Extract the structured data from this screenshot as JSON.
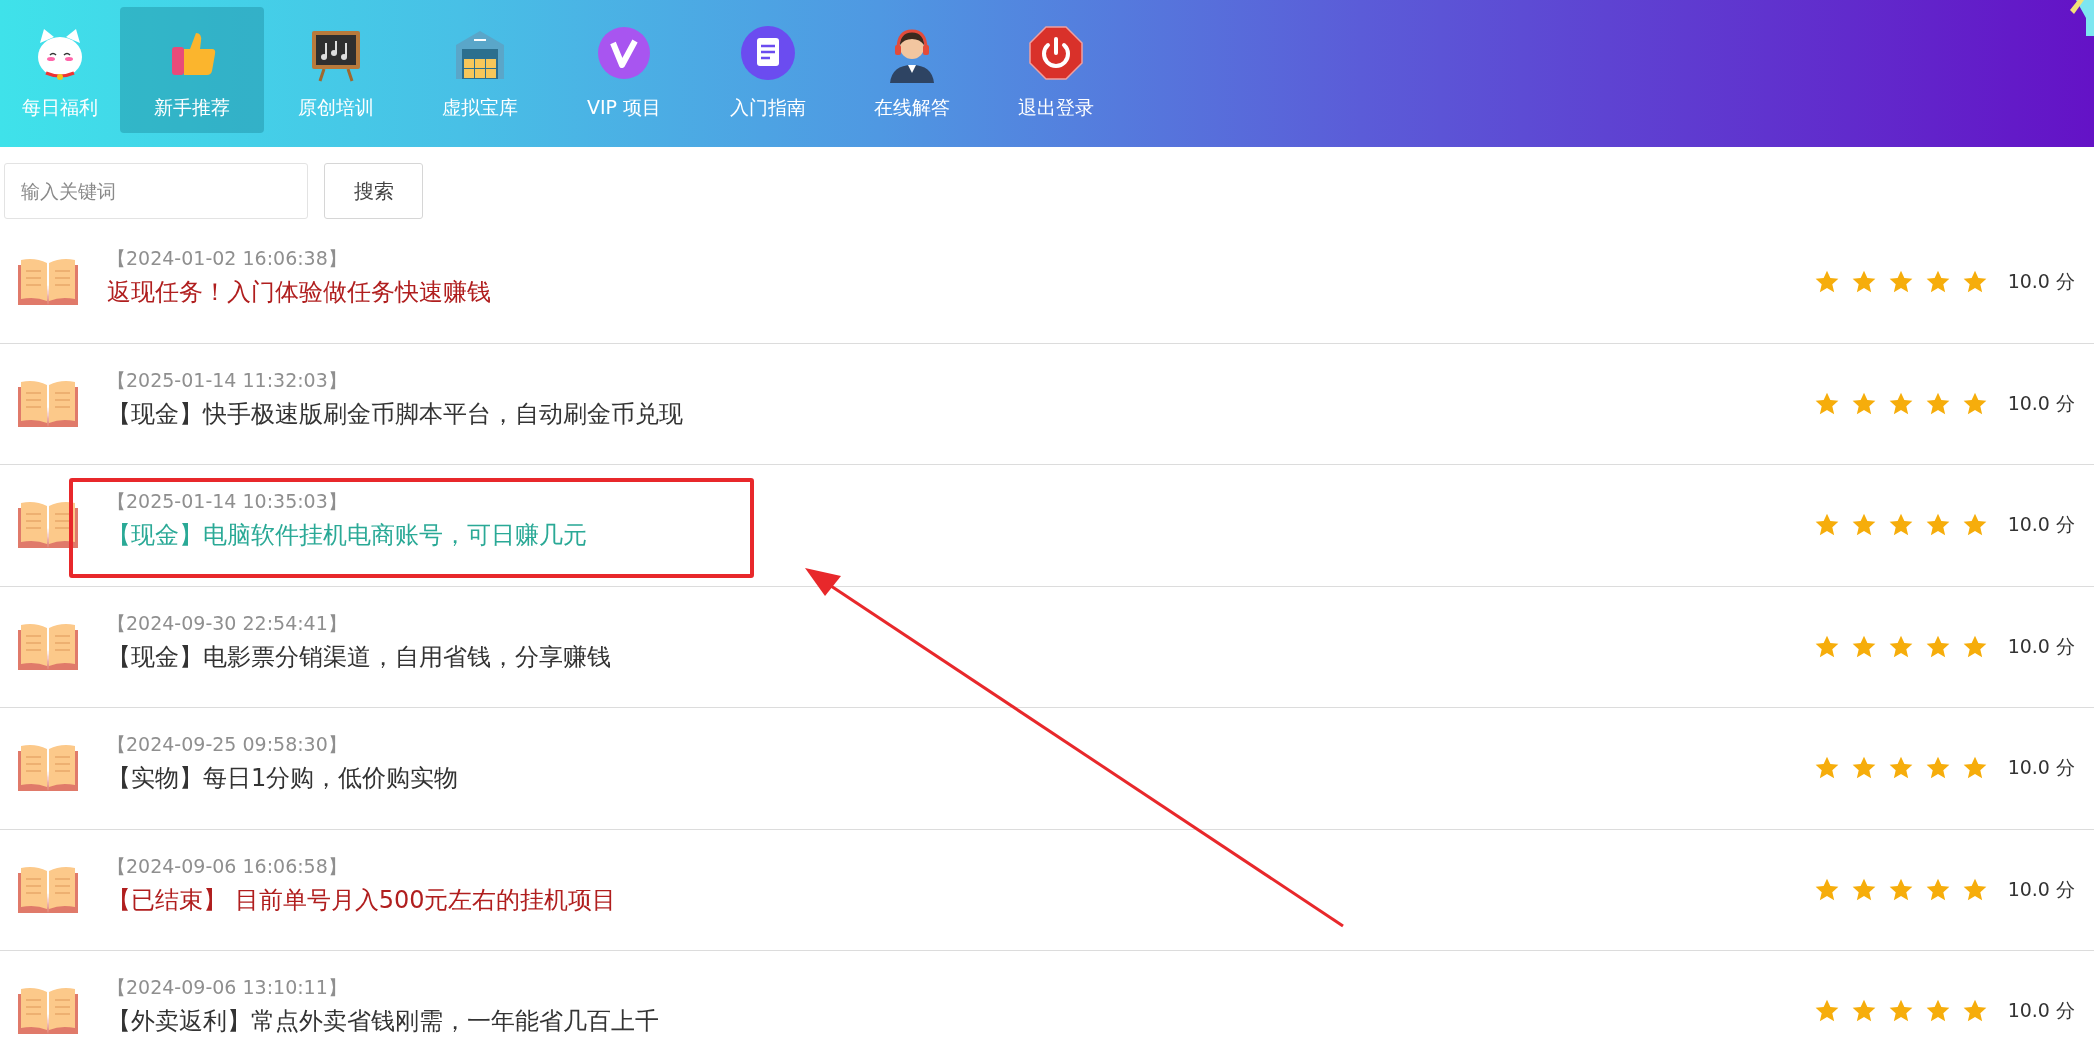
{
  "nav": {
    "items": [
      {
        "kind": "cat",
        "label": "每日福利",
        "selected": false
      },
      {
        "kind": "thumb",
        "label": "新手推荐",
        "selected": true
      },
      {
        "kind": "board",
        "label": "原创培训",
        "selected": false
      },
      {
        "kind": "store",
        "label": "虚拟宝库",
        "selected": false
      },
      {
        "kind": "vip",
        "label": "VIP 项目",
        "selected": false
      },
      {
        "kind": "doc",
        "label": "入门指南",
        "selected": false
      },
      {
        "kind": "agent",
        "label": "在线解答",
        "selected": false
      },
      {
        "kind": "power",
        "label": "退出登录",
        "selected": false
      }
    ]
  },
  "search": {
    "placeholder": "输入关键词",
    "button": "搜索"
  },
  "articles": [
    {
      "date": "【2024-01-02 16:06:38】",
      "title": "返现任务！入门体验做任务快速赚钱",
      "color": "#b01e1e",
      "marked": false,
      "stars": 5,
      "score": "10.0 分"
    },
    {
      "date": "【2025-01-14 11:32:03】",
      "title": "【现金】快手极速版刷金币脚本平台，自动刷金币兑现",
      "color": "#333333",
      "marked": false,
      "stars": 5,
      "score": "10.0 分"
    },
    {
      "date": "【2025-01-14 10:35:03】",
      "title": "【现金】电脑软件挂机电商账号，可日赚几元",
      "color": "#2aa996",
      "marked": true,
      "stars": 5,
      "score": "10.0 分"
    },
    {
      "date": "【2024-09-30 22:54:41】",
      "title": "【现金】电影票分销渠道，自用省钱，分享赚钱",
      "color": "#333333",
      "marked": false,
      "stars": 5,
      "score": "10.0 分"
    },
    {
      "date": "【2024-09-25 09:58:30】",
      "title": "【实物】每日1分购，低价购实物",
      "color": "#333333",
      "marked": false,
      "stars": 5,
      "score": "10.0 分"
    },
    {
      "date": "【2024-09-06 16:06:58】",
      "title": "【已结束】 目前单号月入500元左右的挂机项目",
      "color": "#b01e1e",
      "marked": false,
      "stars": 5,
      "score": "10.0 分"
    },
    {
      "date": "【2024-09-06 13:10:11】",
      "title": "【外卖返利】常点外卖省钱刚需，一年能省几百上千",
      "color": "#333333",
      "marked": false,
      "stars": 5,
      "score": "10.0 分"
    }
  ]
}
